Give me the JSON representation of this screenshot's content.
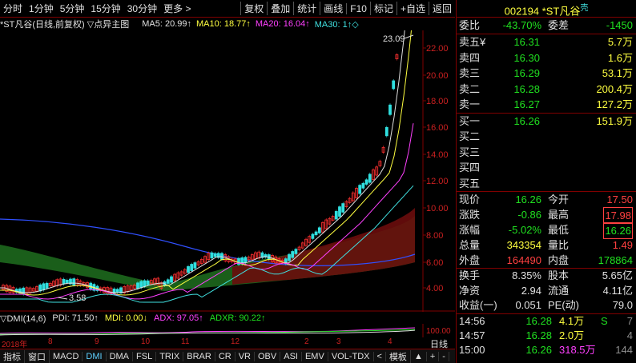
{
  "toolbar": {
    "items": [
      "分时",
      "1分钟",
      "5分钟",
      "15分钟",
      "30分钟",
      "更多 >"
    ],
    "right_items": [
      "复权",
      "叠加",
      "统计",
      "画线",
      "F10",
      "标记",
      "+自选",
      "返回"
    ]
  },
  "chart": {
    "title": "*ST凡谷(日线,前复权) ▽点异主图",
    "ma5": "MA5: 20.99↑",
    "ma10": "MA10: 18.77↑",
    "ma20": "MA20: 16.04↑",
    "ma30": "MA30: 1↑◇",
    "high_label": "23.09",
    "low_label": "3.58",
    "y_ticks": [
      "22.00",
      "20.00",
      "18.00",
      "16.00",
      "14.00",
      "12.00",
      "10.00",
      "8.00",
      "6.00",
      "4.00"
    ],
    "dmi_header": {
      "name": "▽DMI(14,6)",
      "pdi": "PDI: 71.50↑",
      "mdi": "MDI: 0.00↓",
      "adx": "ADX: 97.05↑",
      "adxr": "ADXR: 90.22↑"
    },
    "dmi_tick": "100.00",
    "dates": [
      "2018年",
      "8",
      "9",
      "10",
      "11",
      "12",
      "2",
      "3",
      "4"
    ],
    "right_tool": "日线",
    "tabs": [
      "指标",
      "窗口",
      "MACD",
      "DMI",
      "DMA",
      "FSL",
      "TRIX",
      "BRAR",
      "CR",
      "VR",
      "OBV",
      "ASI",
      "EMV",
      "VOL-TDX",
      "<",
      "模板",
      "▲",
      "+",
      "-"
    ]
  },
  "colors": {
    "red": "#ff4040",
    "green": "#20e020",
    "yellow": "#ffff40",
    "magenta": "#ff40ff",
    "cyan": "#40e0e0",
    "up": "#ff3030",
    "down": "#30e0e0"
  },
  "quote": {
    "code": "002194",
    "name": "*ST凡谷",
    "tag": "壳",
    "weibi_label": "委比",
    "weibi": "-43.70%",
    "weicha_label": "委差",
    "weicha": "-1450",
    "sell": [
      {
        "label": "卖五¥",
        "price": "16.31",
        "vol": "5.7万"
      },
      {
        "label": "卖四",
        "price": "16.30",
        "vol": "1.6万"
      },
      {
        "label": "卖三",
        "price": "16.29",
        "vol": "53.1万"
      },
      {
        "label": "卖二",
        "price": "16.28",
        "vol": "200.4万"
      },
      {
        "label": "卖一",
        "price": "16.27",
        "vol": "127.2万"
      }
    ],
    "buy": [
      {
        "label": "买一",
        "price": "16.26",
        "vol": "151.9万"
      },
      {
        "label": "买二",
        "price": "",
        "vol": ""
      },
      {
        "label": "买三",
        "price": "",
        "vol": ""
      },
      {
        "label": "买四",
        "price": "",
        "vol": ""
      },
      {
        "label": "买五",
        "price": "",
        "vol": ""
      }
    ],
    "stats": [
      {
        "l": "现价",
        "v": "16.26",
        "vc": "green",
        "l2": "今开",
        "v2": "17.50",
        "v2c": "red",
        "box": false
      },
      {
        "l": "涨跌",
        "v": "-0.86",
        "vc": "green",
        "l2": "最高",
        "v2": "17.98",
        "v2c": "red",
        "box": true
      },
      {
        "l": "涨幅",
        "v": "-5.02%",
        "vc": "green",
        "l2": "最低",
        "v2": "16.26",
        "v2c": "green",
        "box": true
      },
      {
        "l": "总量",
        "v": "343354",
        "vc": "yel",
        "l2": "量比",
        "v2": "1.49",
        "v2c": "red",
        "box": false
      },
      {
        "l": "外盘",
        "v": "164490",
        "vc": "red",
        "l2": "内盘",
        "v2": "178864",
        "v2c": "green",
        "box": false
      }
    ],
    "fund": [
      {
        "l": "换手",
        "v": "8.35%",
        "l2": "股本",
        "v2": "5.65亿"
      },
      {
        "l": "净资",
        "v": "2.94",
        "l2": "流通",
        "v2": "4.11亿"
      },
      {
        "l": "收益(一)",
        "v": "0.051",
        "l2": "PE(动)",
        "v2": "79.0"
      }
    ],
    "ticks": [
      {
        "time": "14:56",
        "price": "16.28",
        "vol": "4.1万",
        "vc": "yel",
        "flag": "S",
        "fc": "green",
        "n": "7"
      },
      {
        "time": "14:57",
        "price": "16.28",
        "vol": "2.0万",
        "vc": "yel",
        "flag": "",
        "fc": "wht",
        "n": "4"
      },
      {
        "time": "15:00",
        "price": "16.26",
        "vol": "318.5万",
        "vc": "mag",
        "flag": "",
        "fc": "wht",
        "n": "144"
      }
    ]
  }
}
